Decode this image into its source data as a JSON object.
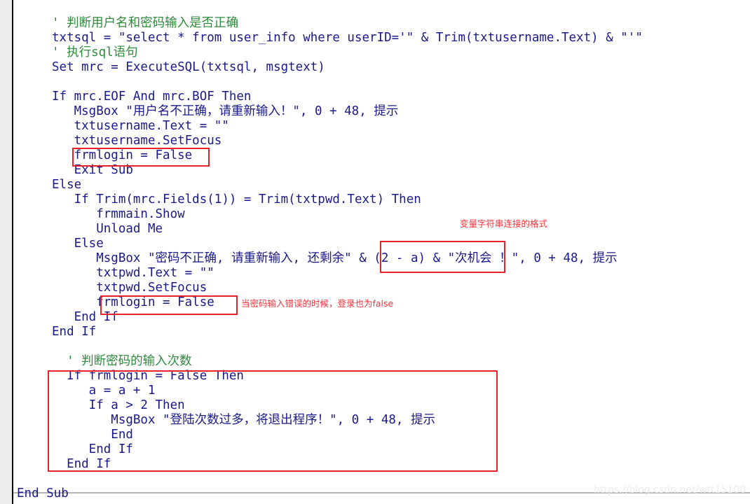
{
  "editor": {
    "language": "Visual Basic 6",
    "gutter_color": "#ececec",
    "background_color": "#ffffff",
    "code_color": "#1a1a8c",
    "comment_color": "#2e8b3c",
    "keyword_color": "#1c24b0",
    "annotation_color": "#f5333b"
  },
  "code_lines": [
    {
      "indent": 4,
      "text": "' 判断用户名和密码输入是否正确",
      "kind": "comment"
    },
    {
      "indent": 4,
      "text": "txtsql = \"select * from user_info where userID='\" & Trim(txtusername.Text) & \"'\"",
      "kind": "code"
    },
    {
      "indent": 4,
      "text": "' 执行sql语句",
      "kind": "comment"
    },
    {
      "indent": 4,
      "text": "Set mrc = ExecuteSQL(txtsql, msgtext)",
      "kind": "code"
    },
    {
      "indent": 4,
      "text": "",
      "kind": "blank"
    },
    {
      "indent": 4,
      "text": "If mrc.EOF And mrc.BOF Then",
      "kind": "code"
    },
    {
      "indent": 6,
      "text": "MsgBox \"用户名不正确，请重新输入！\", 0 + 48, 提示",
      "kind": "code"
    },
    {
      "indent": 6,
      "text": "txtusername.Text = \"\"",
      "kind": "code"
    },
    {
      "indent": 6,
      "text": "txtusername.SetFocus",
      "kind": "code"
    },
    {
      "indent": 6,
      "text": "frmlogin = False",
      "kind": "code"
    },
    {
      "indent": 6,
      "text": "Exit Sub",
      "kind": "code"
    },
    {
      "indent": 4,
      "text": "Else",
      "kind": "code"
    },
    {
      "indent": 6,
      "text": "If Trim(mrc.Fields(1)) = Trim(txtpwd.Text) Then",
      "kind": "code"
    },
    {
      "indent": 8,
      "text": "frmmain.Show",
      "kind": "code"
    },
    {
      "indent": 8,
      "text": "Unload Me",
      "kind": "code"
    },
    {
      "indent": 6,
      "text": "Else",
      "kind": "code"
    },
    {
      "indent": 8,
      "text": "MsgBox \"密码不正确, 请重新输入, 还剩余\" & (2 - a) & \"次机会 ！\", 0 + 48, 提示",
      "kind": "code"
    },
    {
      "indent": 8,
      "text": "txtpwd.Text = \"\"",
      "kind": "code"
    },
    {
      "indent": 8,
      "text": "txtpwd.SetFocus",
      "kind": "code"
    },
    {
      "indent": 8,
      "text": "frmlogin = False",
      "kind": "code"
    },
    {
      "indent": 6,
      "text": "End If",
      "kind": "code"
    },
    {
      "indent": 4,
      "text": "End If",
      "kind": "code"
    },
    {
      "indent": 4,
      "text": "",
      "kind": "blank"
    },
    {
      "indent": 5,
      "text": "' 判断密码的输入次数",
      "kind": "comment"
    },
    {
      "indent": 5,
      "text": "If frmlogin = False Then",
      "kind": "code"
    },
    {
      "indent": 7,
      "text": "a = a + 1",
      "kind": "code"
    },
    {
      "indent": 7,
      "text": "If a > 2 Then",
      "kind": "code"
    },
    {
      "indent": 9,
      "text": "MsgBox \"登陆次数过多，将退出程序！\", 0 + 48, 提示",
      "kind": "code"
    },
    {
      "indent": 9,
      "text": "End",
      "kind": "code"
    },
    {
      "indent": 7,
      "text": "End If",
      "kind": "code"
    },
    {
      "indent": 5,
      "text": "End If",
      "kind": "code"
    },
    {
      "indent": 0,
      "text": "End Sub",
      "kind": "code"
    }
  ],
  "rendered_lines": {
    "l01": "' 判断用户名和密码输入是否正确",
    "l02": "txtsql = \"select * from user_info where userID='\" & Trim(txtusername.Text) & \"'\"",
    "l03": "' 执行sql语句",
    "l04": "Set mrc = ExecuteSQL(txtsql, msgtext)",
    "l05": "If mrc.EOF And mrc.BOF Then",
    "l06": "   MsgBox \"用户名不正确，请重新输入！\", 0 + 48, 提示",
    "l07": "   txtusername.Text = \"\"",
    "l08": "   txtusername.SetFocus",
    "l09": "   frmlogin = False",
    "l10": "   Exit Sub",
    "l11": "Else",
    "l12": "   If Trim(mrc.Fields(1)) = Trim(txtpwd.Text) Then",
    "l13": "      frmmain.Show",
    "l14": "      Unload Me",
    "l15": "   Else",
    "l16": "      MsgBox \"密码不正确, 请重新输入, 还剩余\" & (2 - a) & \"次机会 ！\", 0 + 48, 提示",
    "l17": "      txtpwd.Text = \"\"",
    "l18": "      txtpwd.SetFocus",
    "l19": "      frmlogin = False",
    "l20": "   End If",
    "l21": "End If",
    "l22": "  ' 判断密码的输入次数",
    "l23": "  If frmlogin = False Then",
    "l24": "     a = a + 1",
    "l25": "     If a > 2 Then",
    "l26": "        MsgBox \"登陆次数过多，将退出程序！\", 0 + 48, 提示",
    "l27": "        End",
    "l28": "     End If",
    "l29": "  End If",
    "l30": "End Sub"
  },
  "annotations": [
    {
      "id": "note-string-concat",
      "text": "变量字符串连接的格式"
    },
    {
      "id": "note-login-false",
      "text": "当密码输入错误的时候，登录也为false"
    }
  ],
  "highlight_boxes": [
    {
      "id": "box-frmlogin-false-1",
      "target": "frmlogin = False"
    },
    {
      "id": "box-string-concat",
      "target": "\" & (2 - a) & \""
    },
    {
      "id": "box-frmlogin-false-2",
      "target": "frmlogin = False"
    },
    {
      "id": "box-retry-count-block",
      "target": "If frmlogin = False Then ... End If"
    }
  ],
  "watermark": {
    "text": "https://blog.csdn.net/wtt15100"
  }
}
